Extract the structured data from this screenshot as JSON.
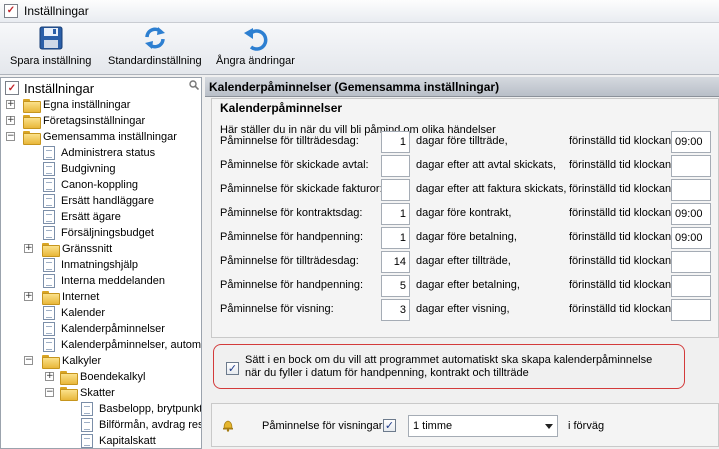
{
  "window": {
    "title": "Inställningar"
  },
  "toolbar": {
    "save_label": "Spara inställning",
    "default_label": "Standardinställning",
    "undo_label": "Ångra ändringar"
  },
  "tree": {
    "root_label": "Inställningar",
    "items": [
      {
        "label": "Egna inställningar",
        "type": "folder",
        "expander": "+"
      },
      {
        "label": "Företagsinställningar",
        "type": "folder",
        "expander": "+"
      },
      {
        "label": "Gemensamma inställningar",
        "type": "folder",
        "expander": "−"
      },
      {
        "label": "Administrera status",
        "type": "doc"
      },
      {
        "label": "Budgivning",
        "type": "doc"
      },
      {
        "label": "Canon-koppling",
        "type": "doc"
      },
      {
        "label": "Ersätt handläggare",
        "type": "doc"
      },
      {
        "label": "Ersätt ägare",
        "type": "doc"
      },
      {
        "label": "Försäljningsbudget",
        "type": "doc"
      },
      {
        "label": "Gränssnitt",
        "type": "folder",
        "expander": "+"
      },
      {
        "label": "Inmatningshjälp",
        "type": "doc"
      },
      {
        "label": "Interna meddelanden",
        "type": "doc"
      },
      {
        "label": "Internet",
        "type": "folder",
        "expander": "+"
      },
      {
        "label": "Kalender",
        "type": "doc"
      },
      {
        "label": "Kalenderpåminnelser",
        "type": "doc"
      },
      {
        "label": "Kalenderpåminnelser, automat",
        "type": "doc"
      },
      {
        "label": "Kalkyler",
        "type": "folder",
        "expander": "−"
      },
      {
        "label": "Boendekalkyl",
        "type": "folder",
        "expander": "+"
      },
      {
        "label": "Skatter",
        "type": "folder",
        "expander": "−"
      },
      {
        "label": "Basbelopp, brytpunkte",
        "type": "doc"
      },
      {
        "label": "Bilförmån, avdrag reso",
        "type": "doc"
      },
      {
        "label": "Kapitalskatt",
        "type": "doc"
      }
    ]
  },
  "main": {
    "header": "Kalenderpåminnelser (Gemensamma inställningar)",
    "group_title": "Kalenderpåminnelser",
    "description": "Här ställer du in när du vill bli påmind om olika händelser",
    "preset_label": "förinställd tid klockan",
    "rows": [
      {
        "label": "Påminnelse för tillträdesdag:",
        "value": "1",
        "text": "dagar före tillträde,",
        "time": "09:00"
      },
      {
        "label": "Påminnelse för skickade avtal:",
        "value": "",
        "text": "dagar efter att avtal skickats,",
        "time": ""
      },
      {
        "label": "Påminnelse för skickade fakturor:",
        "value": "",
        "text": "dagar efter att faktura skickats,",
        "time": ""
      },
      {
        "label": "Påminnelse för kontraktsdag:",
        "value": "1",
        "text": "dagar före kontrakt,",
        "time": "09:00"
      },
      {
        "label": "Påminnelse för handpenning:",
        "value": "1",
        "text": "dagar före betalning,",
        "time": "09:00"
      },
      {
        "label": "Påminnelse för tillträdesdag:",
        "value": "14",
        "text": "dagar efter tillträde,",
        "time": ""
      },
      {
        "label": "Påminnelse för handpenning:",
        "value": "5",
        "text": "dagar efter betalning,",
        "time": ""
      },
      {
        "label": "Påminnelse för visning:",
        "value": "3",
        "text": "dagar efter visning,",
        "time": ""
      }
    ],
    "auto": {
      "checked": true,
      "line1": "Sätt i en bock om du vill att programmet automatiskt ska skapa kalenderpåminnelse",
      "line2": "när du fyller i datum för handpenning, kontrakt och tillträde"
    },
    "viewing": {
      "label": "Påminnelse för visningar",
      "checked": true,
      "select_value": "1 timme",
      "suffix": "i förväg"
    }
  }
}
